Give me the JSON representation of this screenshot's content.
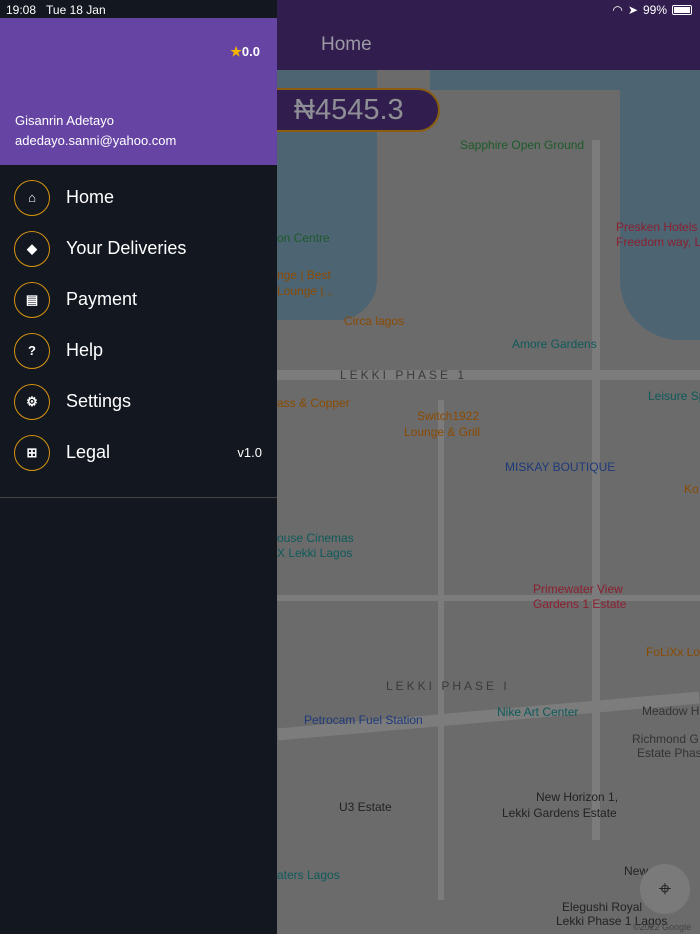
{
  "status_bar": {
    "time": "19:08",
    "date": "Tue 18 Jan",
    "battery": "99%",
    "battery_level": 0.99
  },
  "app_bar": {
    "title": "Home"
  },
  "balance": {
    "amount": "₦4545.3"
  },
  "drawer": {
    "rating": "0.0",
    "user_name": "Gisanrin Adetayo",
    "user_email": "adedayo.sanni@yahoo.com",
    "items": [
      {
        "label": "Home",
        "icon": "home-icon"
      },
      {
        "label": "Your Deliveries",
        "icon": "directions-icon"
      },
      {
        "label": "Payment",
        "icon": "credit-card-icon"
      },
      {
        "label": "Help",
        "icon": "help-icon"
      },
      {
        "label": "Settings",
        "icon": "gear-icon"
      },
      {
        "label": "Legal",
        "icon": "legal-icon"
      }
    ],
    "version": "v1.0"
  },
  "map": {
    "labels": [
      {
        "text": "Sapphire Open Ground",
        "color": "#1d5a2a"
      },
      {
        "text": "Presken Hotels",
        "color": "#8a2030"
      },
      {
        "text": "Freedom way, L",
        "color": "#8a2030"
      },
      {
        "text": "on Centre",
        "color": "#1d5a2a"
      },
      {
        "text": "nge | Best",
        "color": "#8a4a00"
      },
      {
        "text": "Lounge |...",
        "color": "#8a4a00"
      },
      {
        "text": "Circa lagos",
        "color": "#8a4a00"
      },
      {
        "text": "Amore Gardens",
        "color": "#0f5a5a"
      },
      {
        "text": "LEKKI PHASE 1",
        "color": "#3a3a3a"
      },
      {
        "text": "Leisure Sp",
        "color": "#0f5a5a"
      },
      {
        "text": "ass & Copper",
        "color": "#8a4a00"
      },
      {
        "text": "Switch1922",
        "color": "#8a4a00"
      },
      {
        "text": "Lounge & Grill",
        "color": "#8a4a00"
      },
      {
        "text": "MISKAY BOUTIQUE",
        "color": "#1e3a7a"
      },
      {
        "text": "Ko",
        "color": "#8a4a00"
      },
      {
        "text": "ouse Cinemas",
        "color": "#0f5a5a"
      },
      {
        "text": "X Lekki Lagos",
        "color": "#0f5a5a"
      },
      {
        "text": "Primewater View",
        "color": "#8a2030"
      },
      {
        "text": "Gardens 1 Estate",
        "color": "#8a2030"
      },
      {
        "text": "FoLiXx Lo",
        "color": "#8a4a00"
      },
      {
        "text": "LEKKI PHASE I",
        "color": "#3a3a3a"
      },
      {
        "text": "Petrocam Fuel Station",
        "color": "#1e3a7a"
      },
      {
        "text": "Nike Art Center",
        "color": "#0f5a5a"
      },
      {
        "text": "Meadow H",
        "color": "#333"
      },
      {
        "text": "Richmond G",
        "color": "#333"
      },
      {
        "text": "Estate Phas",
        "color": "#333"
      },
      {
        "text": "U3 Estate",
        "color": "#222"
      },
      {
        "text": "New Horizon 1,",
        "color": "#222"
      },
      {
        "text": "Lekki Gardens Estate",
        "color": "#222"
      },
      {
        "text": "aters Lagos",
        "color": "#0f5a5a"
      },
      {
        "text": "New",
        "color": "#222"
      },
      {
        "text": "Elegushi Royal",
        "color": "#222"
      },
      {
        "text": "Lekki Phase 1 Lagos",
        "color": "#222"
      }
    ],
    "copyright": "©2022 Google"
  }
}
